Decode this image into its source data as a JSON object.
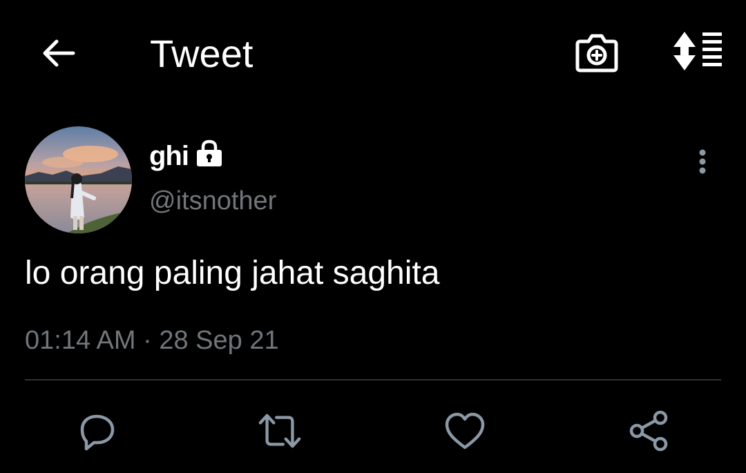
{
  "header": {
    "title": "Tweet",
    "back_icon": "arrow-left-icon",
    "camera_icon": "camera-plus-icon",
    "sort_icon": "sort-list-icon"
  },
  "tweet": {
    "display_name": "ghi",
    "protected_icon": "lock-icon",
    "handle": "@itsnother",
    "text": "lo orang paling jahat saghita",
    "time": "01:14 AM",
    "separator": "·",
    "date": "28 Sep 21",
    "more_icon": "more-vertical-icon"
  },
  "actions": [
    {
      "name": "reply",
      "icon": "reply-icon"
    },
    {
      "name": "retweet",
      "icon": "retweet-icon"
    },
    {
      "name": "like",
      "icon": "heart-icon"
    },
    {
      "name": "share",
      "icon": "share-icon"
    }
  ],
  "colors": {
    "background": "#000000",
    "text": "#ffffff",
    "secondary": "#71767b",
    "action_icon": "#8b98a5",
    "divider": "#2f3336"
  }
}
